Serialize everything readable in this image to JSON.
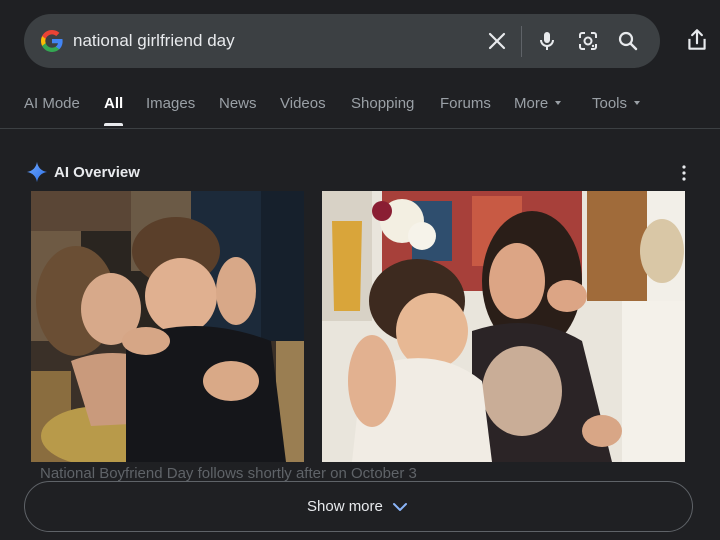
{
  "search": {
    "query": "national girlfriend day",
    "icons": [
      "google-logo",
      "clear-icon",
      "microphone-icon",
      "lens-icon",
      "search-icon",
      "share-icon"
    ]
  },
  "tabs": [
    {
      "label": "AI Mode",
      "active": false
    },
    {
      "label": "All",
      "active": true
    },
    {
      "label": "Images",
      "active": false
    },
    {
      "label": "News",
      "active": false
    },
    {
      "label": "Videos",
      "active": false
    },
    {
      "label": "Shopping",
      "active": false
    },
    {
      "label": "Forums",
      "active": false
    },
    {
      "label": "More",
      "active": false,
      "dropdown": true
    },
    {
      "label": "Tools",
      "active": false,
      "dropdown": true
    }
  ],
  "ai_overview": {
    "title": "AI Overview",
    "snippet": "National Boyfriend Day follows shortly after on October 3"
  },
  "images": [
    {
      "description": "couple-hugging-on-couch"
    },
    {
      "description": "couple-laughing-at-party"
    }
  ],
  "show_more": {
    "label": "Show more"
  },
  "colors": {
    "background": "#1f2023",
    "search_bar": "#3c4043",
    "text": "#e8eaed",
    "muted_text": "#9aa0a6",
    "ai_accent": "#4285f4"
  }
}
